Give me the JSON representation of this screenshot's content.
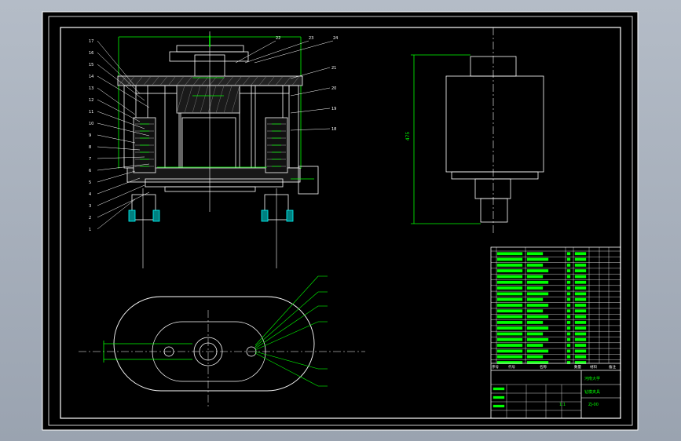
{
  "viewer": {
    "background": "#a3acb9",
    "canvas_background": "#000000",
    "line_color": "#ffffff",
    "accent_green": "#00ff00",
    "accent_cyan": "#00ffff",
    "accent_red": "#ff4040"
  },
  "section_view": {
    "balloons_left": [
      "17",
      "16",
      "15",
      "14",
      "13",
      "12",
      "11",
      "10",
      "9",
      "8",
      "7",
      "6",
      "5",
      "4",
      "3",
      "2",
      "1"
    ],
    "balloons_top": [
      "22",
      "23",
      "24"
    ],
    "balloons_right": [
      "21",
      "20",
      "19",
      "18"
    ]
  },
  "side_view": {
    "dimension": "475"
  },
  "title_block": {
    "heading_cols": [
      "序号",
      "代号",
      "名称",
      "数量",
      "材料",
      "备注"
    ],
    "school": "河南大学",
    "drawing_title": "钻模夹具",
    "drawing_number": "ZJ-00",
    "scale": "1:1"
  }
}
